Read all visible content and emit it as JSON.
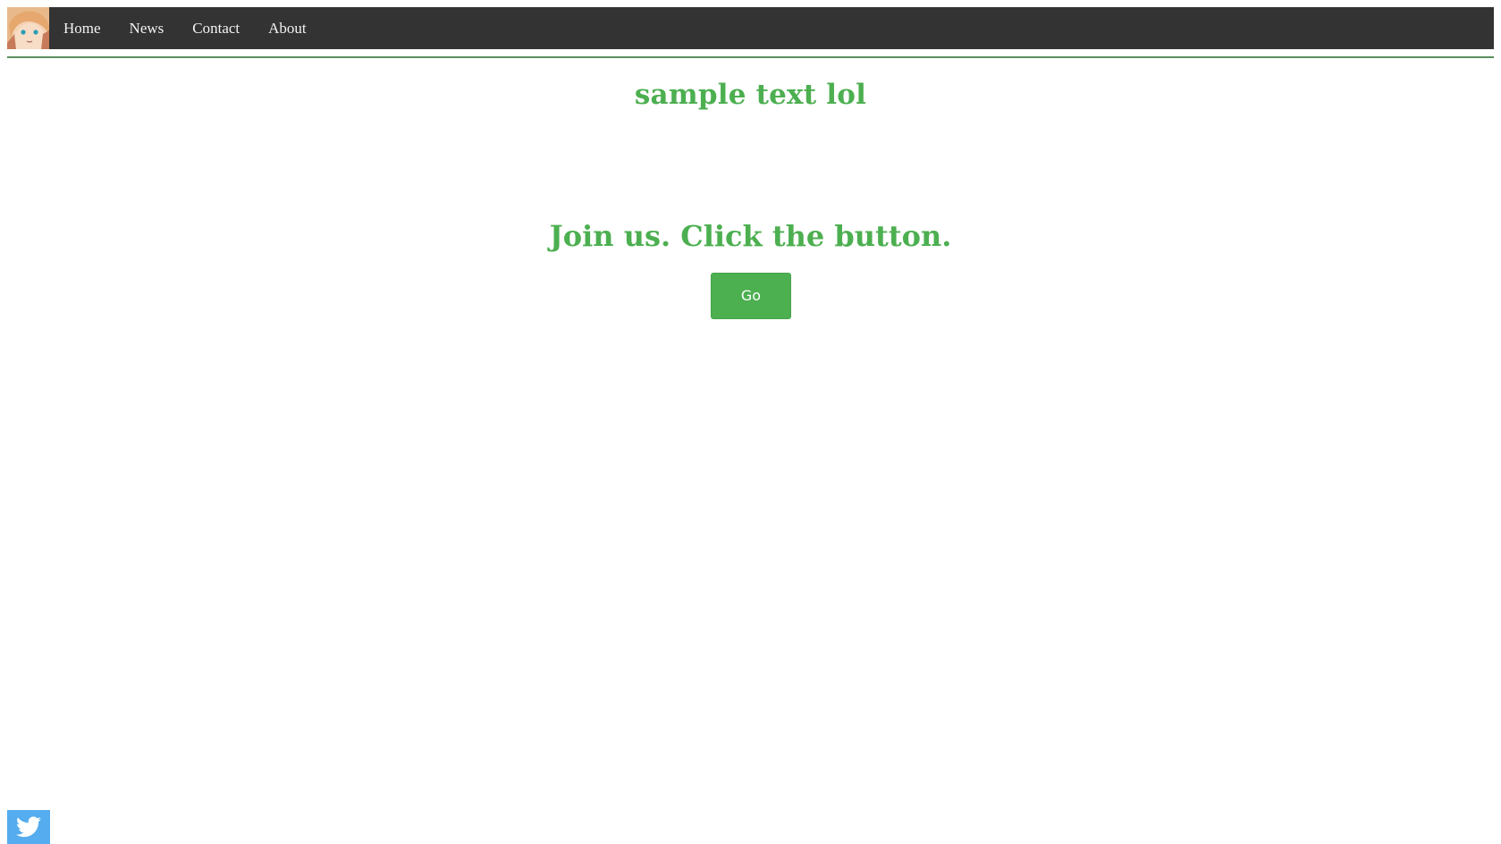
{
  "nav": {
    "logo_icon": "anime-avatar-logo",
    "links": [
      "Home",
      "News",
      "Contact",
      "About"
    ]
  },
  "main": {
    "title": "sample text lol",
    "cta_heading": "Join us. Click the button.",
    "button_label": "Go"
  },
  "footer": {
    "social_icon": "twitter-icon"
  },
  "colors": {
    "navbar_bg": "#333333",
    "nav_text": "#f2f2f2",
    "accent_green": "#4caf50",
    "divider": "#5a8f5e",
    "twitter_blue": "#55acee"
  }
}
